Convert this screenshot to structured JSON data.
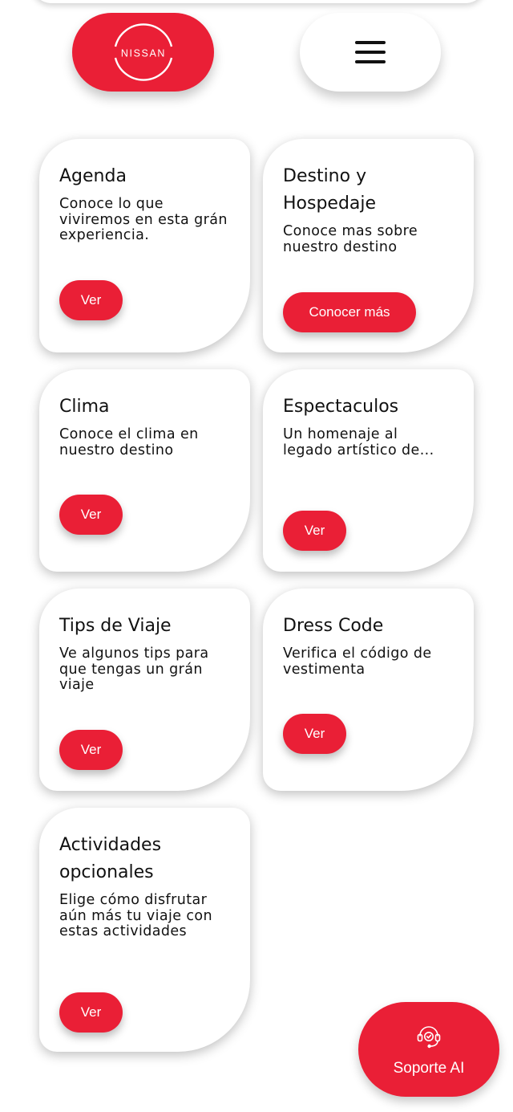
{
  "header": {
    "logo_text": "NISSAN"
  },
  "cards": [
    {
      "title": "Agenda",
      "description": "Conoce lo que viviremos en esta grán experiencia.",
      "button": "Ver"
    },
    {
      "title": "Destino y Hospedaje",
      "description": "Conoce mas sobre nuestro destino",
      "button": "Conocer más"
    },
    {
      "title": "Clima",
      "description": "Conoce el clima en nuestro destino",
      "button": "Ver"
    },
    {
      "title": "Espectaculos",
      "description": "Un homenaje al legado artístico de...",
      "button": "Ver"
    },
    {
      "title": "Tips de Viaje",
      "description": "Ve algunos tips para que tengas un grán viaje",
      "button": "Ver"
    },
    {
      "title": "Dress Code",
      "description": "Verifica el código de vestimenta",
      "button": "Ver"
    },
    {
      "title": "Actividades opcionales",
      "description": "Elige cómo disfrutar aún más tu viaje con estas actividades",
      "button": "Ver"
    }
  ],
  "support": {
    "label": "Soporte AI",
    "icon": "headset-icon"
  },
  "colors": {
    "accent": "#ea1f36",
    "card_bg": "#ffffff",
    "text": "#111111"
  }
}
